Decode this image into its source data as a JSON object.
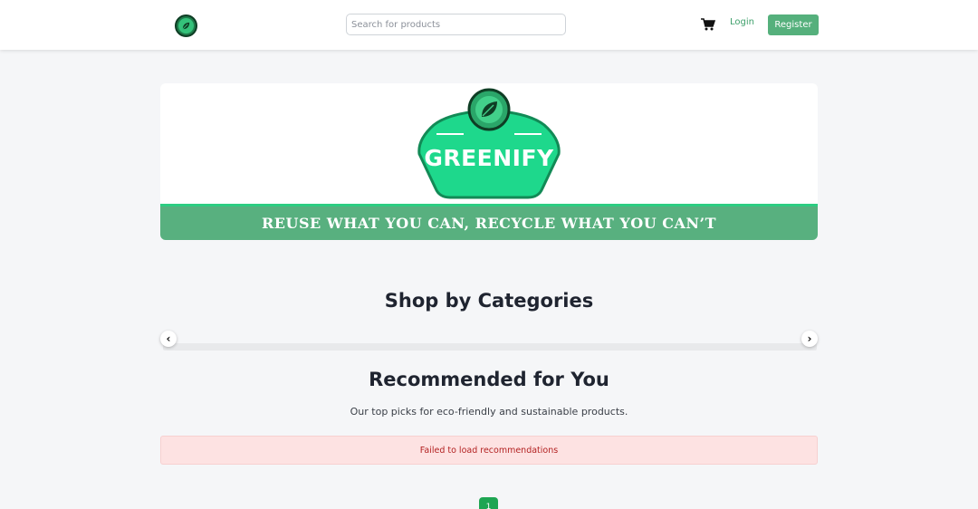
{
  "header": {
    "logo": "leaf-logo-icon",
    "search_placeholder": "Search for products",
    "cart_icon": "cart-icon",
    "login_label": "Login",
    "register_label": "Register"
  },
  "banner": {
    "brand": "GREENIFY",
    "tagline": "REUSE WHAT YOU CAN, RECYCLE WHAT YOU CAN’T",
    "strip_color": "#58b07f",
    "badge_color": "#1ed88c"
  },
  "categories": {
    "heading": "Shop by Categories",
    "prev_icon": "chevron-left-icon",
    "next_icon": "chevron-right-icon"
  },
  "recommended": {
    "heading": "Recommended for You",
    "subtitle": "Our top picks for eco-friendly and sustainable products.",
    "error": "Failed to load recommendations"
  },
  "pagination": {
    "current_page": "1"
  },
  "colors": {
    "accent": "#55b07c",
    "error_bg": "#fde2e2",
    "error_text": "#b32222"
  }
}
